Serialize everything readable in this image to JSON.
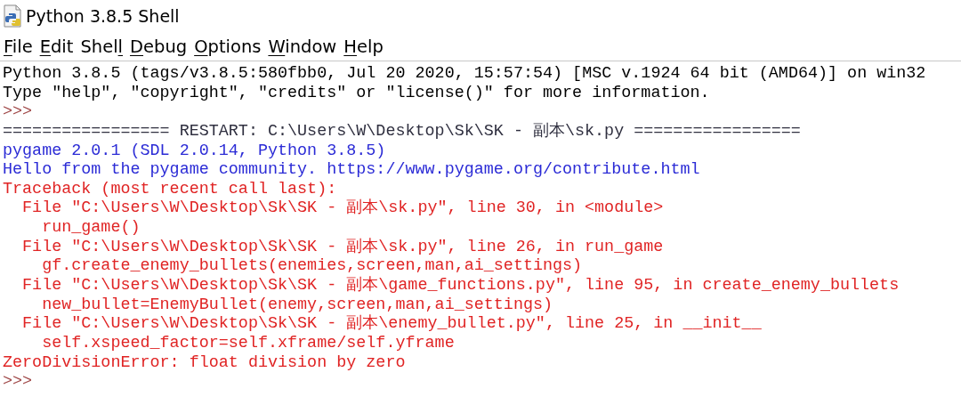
{
  "window": {
    "title": "Python 3.8.5 Shell"
  },
  "menu": [
    {
      "key": "F",
      "after": "ile"
    },
    {
      "key": "E",
      "after": "dit"
    },
    {
      "before": "Shel",
      "key": "l"
    },
    {
      "key": "D",
      "after": "ebug"
    },
    {
      "key": "O",
      "after": "ptions"
    },
    {
      "key": "W",
      "after": "indow"
    },
    {
      "key": "H",
      "after": "elp"
    }
  ],
  "shell": {
    "lines": [
      {
        "kind": "info",
        "text": "Python 3.8.5 (tags/v3.8.5:580fbb0, Jul 20 2020, 15:57:54) [MSC v.1924 64 bit (AMD64)] on win32"
      },
      {
        "kind": "info",
        "text": "Type \"help\", \"copyright\", \"credits\" or \"license()\" for more information."
      },
      {
        "kind": "prompt",
        "text": ">>>"
      },
      {
        "kind": "restart",
        "text": "================= RESTART: C:\\Users\\W\\Desktop\\Sk\\SK - 副本\\sk.py ================="
      },
      {
        "kind": "stdout",
        "text": "pygame 2.0.1 (SDL 2.0.14, Python 3.8.5)"
      },
      {
        "kind": "stdout",
        "text": "Hello from the pygame community. https://www.pygame.org/contribute.html"
      },
      {
        "kind": "stderr",
        "text": "Traceback (most recent call last):"
      },
      {
        "kind": "stderr",
        "text": "  File \"C:\\Users\\W\\Desktop\\Sk\\SK - 副本\\sk.py\", line 30, in <module>"
      },
      {
        "kind": "stderr",
        "text": "    run_game()"
      },
      {
        "kind": "stderr",
        "text": "  File \"C:\\Users\\W\\Desktop\\Sk\\SK - 副本\\sk.py\", line 26, in run_game"
      },
      {
        "kind": "stderr",
        "text": "    gf.create_enemy_bullets(enemies,screen,man,ai_settings)"
      },
      {
        "kind": "stderr",
        "text": "  File \"C:\\Users\\W\\Desktop\\Sk\\SK - 副本\\game_functions.py\", line 95, in create_enemy_bullets"
      },
      {
        "kind": "stderr",
        "text": "    new_bullet=EnemyBullet(enemy,screen,man,ai_settings)"
      },
      {
        "kind": "stderr",
        "text": "  File \"C:\\Users\\W\\Desktop\\Sk\\SK - 副本\\enemy_bullet.py\", line 25, in __init__"
      },
      {
        "kind": "stderr",
        "text": "    self.xspeed_factor=self.xframe/self.yframe"
      },
      {
        "kind": "stderr",
        "text": "ZeroDivisionError: float division by zero"
      },
      {
        "kind": "prompt",
        "text": ">>>"
      }
    ]
  }
}
